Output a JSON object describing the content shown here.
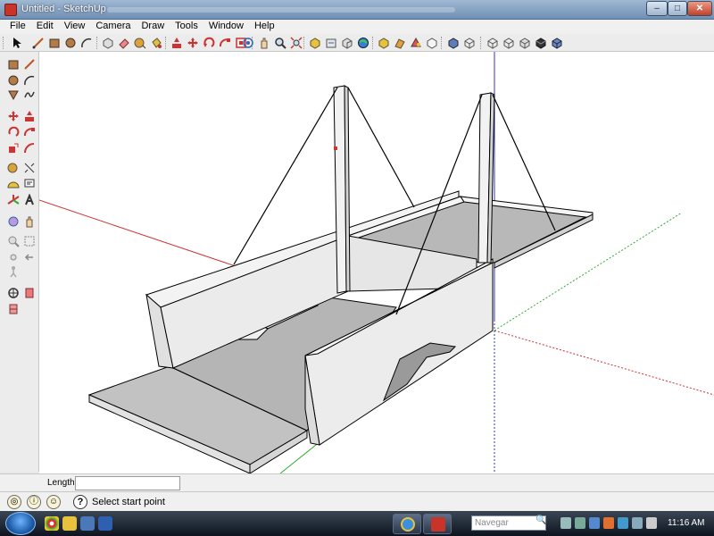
{
  "window": {
    "title": "Untitled - SketchUp",
    "minimize_glyph": "–",
    "maximize_glyph": "□",
    "close_glyph": "✕"
  },
  "menu": [
    "File",
    "Edit",
    "View",
    "Camera",
    "Draw",
    "Tools",
    "Window",
    "Help"
  ],
  "top_toolbar_icons": [
    "select-icon",
    "line-icon",
    "rectangle-icon",
    "circle-icon",
    "arc-icon",
    "make-component-icon",
    "eraser-icon",
    "tape-measure-icon",
    "paint-bucket-icon",
    "push-pull-icon",
    "move-icon",
    "rotate-icon",
    "follow-me-icon",
    "offset-icon",
    "orbit-icon",
    "pan-icon",
    "zoom-icon",
    "zoom-extents-icon",
    "get-models-icon",
    "share-model-icon",
    "share-component-icon",
    "preview-google-earth-icon",
    "components-browser-icon",
    "get-photo-texture-icon",
    "materials-icon",
    "styles-icon",
    "iso-view-icon",
    "top-view-icon",
    "front-view-icon",
    "right-view-icon",
    "back-view-icon",
    "left-view-icon",
    "xray-icon",
    "shaded-textures-icon"
  ],
  "left_toolbar_icons": [
    "rectangle-icon",
    "line-icon",
    "circle-icon",
    "arc-icon",
    "polygon-icon",
    "freehand-icon",
    "move-icon",
    "push-pull-icon",
    "rotate-icon",
    "follow-me-icon",
    "scale-icon",
    "offset-icon",
    "tape-measure-icon",
    "dimension-icon",
    "protractor-icon",
    "text-icon",
    "axes-icon",
    "3d-text-icon",
    "orbit-icon",
    "pan-icon",
    "zoom-icon",
    "zoom-window-icon",
    "zoom-extents-icon",
    "previous-view-icon",
    "walk-icon",
    "look-around-icon",
    "position-camera-icon",
    "section-plane-icon"
  ],
  "measurements": {
    "label": "Length",
    "value": ""
  },
  "status": {
    "text": "Select start point",
    "help_glyph": "?",
    "icons": [
      "geo-location-icon",
      "credits-icon",
      "user-icon"
    ]
  },
  "taskbar": {
    "search_placeholder": "Navegar",
    "search_glyph": "🔍",
    "clock": "11:16 AM",
    "quick_launch": [
      "chrome-icon",
      "explorer-icon",
      "desktop-icon",
      "outlook-icon"
    ],
    "tasks": [
      "ie-task-icon",
      "sketchup-task-icon"
    ]
  },
  "colors": {
    "background": "#ffffff",
    "face_top": "#c6c6c6",
    "face_side": "#e6e6e6",
    "face_dark": "#a8a8a8",
    "edge": "#000000",
    "axis_red": "#cc3333",
    "axis_green": "#33aa33",
    "axis_blue": "#3333cc"
  }
}
